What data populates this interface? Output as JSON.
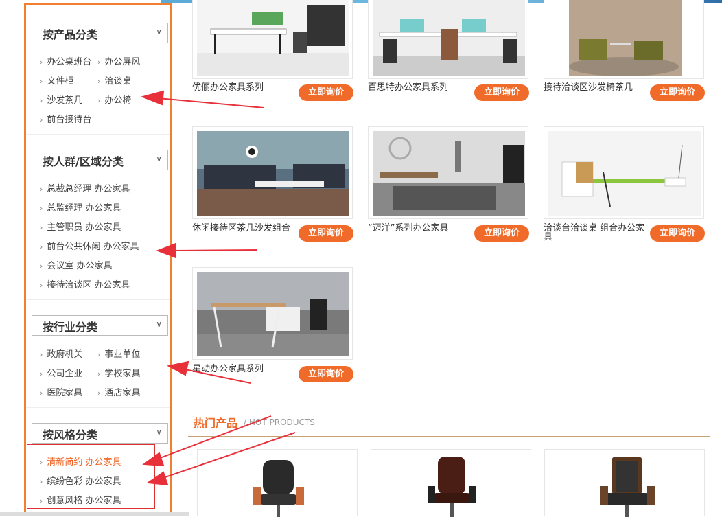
{
  "sidebar": {
    "sections": [
      {
        "title": "按产品分类",
        "items": [
          "办公桌班台",
          "办公屏风",
          "文件柜",
          "洽谈桌",
          "沙发茶几",
          "办公椅",
          "前台接待台"
        ]
      },
      {
        "title": "按人群/区域分类",
        "items": [
          "总裁总经理 办公家具",
          "总监经理 办公家具",
          "主管职员 办公家具",
          "前台公共休闲 办公家具",
          "会议室 办公家具",
          "接待洽谈区 办公家具"
        ]
      },
      {
        "title": "按行业分类",
        "items": [
          "政府机关",
          "事业单位",
          "公司企业",
          "学校家具",
          "医院家具",
          "酒店家具"
        ]
      },
      {
        "title": "按风格分类",
        "items": [
          "清新简约 办公家具",
          "缤纷色彩 办公家具",
          "创意风格 办公家具"
        ]
      }
    ]
  },
  "products": [
    {
      "name": "优俪办公家具系列",
      "button": "立即询价"
    },
    {
      "name": "百思特办公家具系列",
      "button": "立即询价"
    },
    {
      "name": "接待洽谈区沙发椅茶几",
      "button": "立即询价"
    },
    {
      "name": "休闲接待区茶几沙发组合",
      "button": "立即询价"
    },
    {
      "name": "“迈洋”系列办公家具",
      "button": "立即询价"
    },
    {
      "name": "洽谈台洽谈桌 组合办公家具",
      "button": "立即询价"
    },
    {
      "name": "星动办公家具系列",
      "button": "立即询价"
    }
  ],
  "hot": {
    "title": "热门产品",
    "subtitle": "/ HOT PRODUCTS"
  },
  "colors": {
    "accent": "#f06a2a",
    "border": "#f08030",
    "arrow": "#e8303a"
  }
}
